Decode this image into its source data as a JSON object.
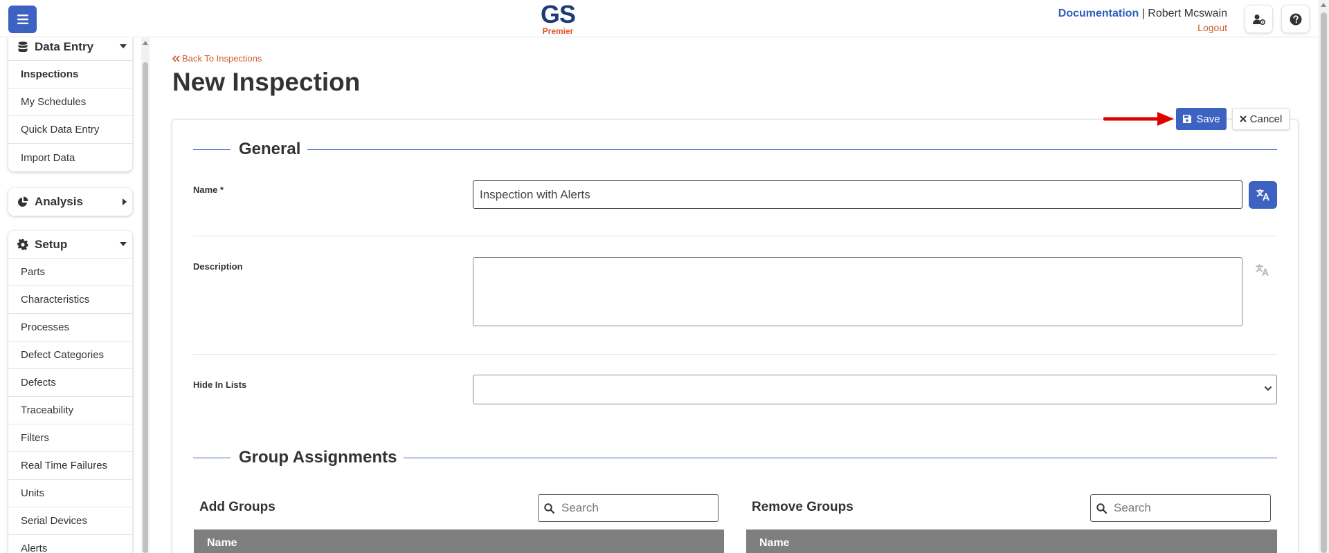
{
  "header": {
    "logo_main": "GS",
    "logo_sub": "Premier",
    "documentation": "Documentation",
    "separator": "|",
    "user_name": "Robert Mcswain",
    "logout": "Logout"
  },
  "sidebar": {
    "data_entry": {
      "title": "Data Entry",
      "items": [
        "Inspections",
        "My Schedules",
        "Quick Data Entry",
        "Import Data"
      ]
    },
    "analysis": {
      "title": "Analysis"
    },
    "setup": {
      "title": "Setup",
      "items": [
        "Parts",
        "Characteristics",
        "Processes",
        "Defect Categories",
        "Defects",
        "Traceability",
        "Filters",
        "Real Time Failures",
        "Units",
        "Serial Devices",
        "Alerts"
      ]
    }
  },
  "page": {
    "back_link": "Back To Inspections",
    "title": "New Inspection"
  },
  "actions": {
    "save": "Save",
    "cancel": "Cancel"
  },
  "general": {
    "title": "General",
    "name_label": "Name *",
    "name_value": "Inspection with Alerts",
    "description_label": "Description",
    "hide_label": "Hide In Lists"
  },
  "groups": {
    "title": "Group Assignments",
    "add_title": "Add Groups",
    "remove_title": "Remove Groups",
    "search_placeholder": "Search",
    "col_name": "Name"
  },
  "colors": {
    "accent": "#3e62c1",
    "link_orange": "#d05b2c",
    "arrow_red": "#e00000",
    "table_head": "#7f7f7f"
  }
}
